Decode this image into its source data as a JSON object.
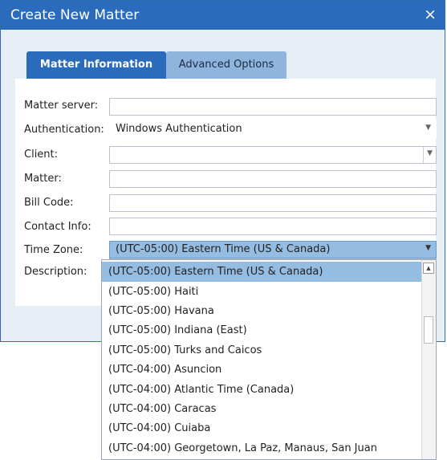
{
  "dialog": {
    "title": "Create New Matter",
    "close_icon": "×"
  },
  "tabs": [
    {
      "label": "Matter Information",
      "active": true
    },
    {
      "label": "Advanced Options",
      "active": false
    }
  ],
  "form": {
    "matter_server_label": "Matter server:",
    "matter_server_value": "",
    "authentication_label": "Authentication:",
    "authentication_value": "Windows Authentication",
    "client_label": "Client:",
    "client_value": "",
    "matter_label": "Matter:",
    "matter_value": "",
    "bill_code_label": "Bill Code:",
    "bill_code_value": "",
    "contact_info_label": "Contact Info:",
    "contact_info_value": "",
    "time_zone_label": "Time Zone:",
    "time_zone_value": "(UTC-05:00) Eastern Time (US & Canada)",
    "description_label": "Description:"
  },
  "time_zone_options": [
    "(UTC-05:00) Eastern Time (US & Canada)",
    "(UTC-05:00) Haiti",
    "(UTC-05:00) Havana",
    "(UTC-05:00) Indiana (East)",
    "(UTC-05:00) Turks and Caicos",
    "(UTC-04:00) Asuncion",
    "(UTC-04:00) Atlantic Time (Canada)",
    "(UTC-04:00) Caracas",
    "(UTC-04:00) Cuiaba",
    "(UTC-04:00) Georgetown, La Paz, Manaus, San Juan"
  ],
  "colors": {
    "accent": "#2a6cbb",
    "selected": "#95bde2",
    "inactive_tab": "#8fb5de"
  },
  "icons": {
    "close": "close-icon",
    "dropdown": "chevron-down-icon",
    "scroll_up": "chevron-up-icon"
  }
}
